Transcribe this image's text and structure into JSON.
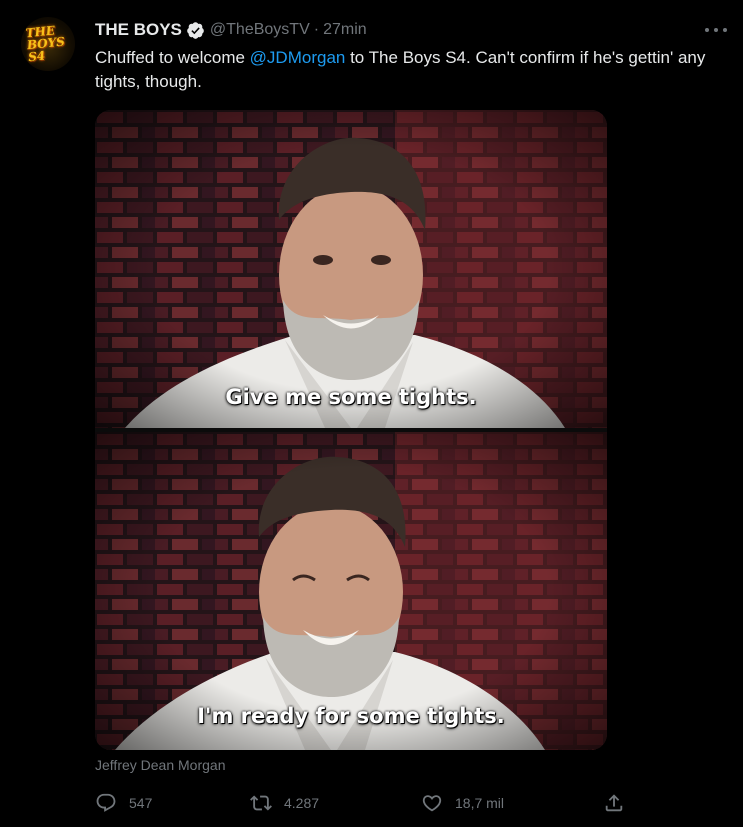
{
  "tweet": {
    "avatar_logo_lines": [
      "THE",
      "BOYS",
      "S4"
    ],
    "display_name": "THE BOYS",
    "handle": "@TheBoysTV",
    "separator": "·",
    "time": "27min",
    "text_before": "Chuffed to welcome ",
    "mention": "@JDMorgan",
    "text_after": " to The Boys S4. Can't confirm if he's gettin' any tights, though.",
    "media": {
      "top_caption": "Give me some tights.",
      "bottom_caption": "I'm ready for some tights."
    },
    "media_label": "Jeffrey Dean Morgan",
    "stats": {
      "replies": "547",
      "retweets": "4.287",
      "likes": "18,7 mil"
    }
  },
  "colors": {
    "background": "#000000",
    "text": "#e7e9ea",
    "secondary": "#71767b",
    "link": "#1d9bf0"
  },
  "icons": [
    "verified-badge-icon",
    "more-icon",
    "reply-icon",
    "retweet-icon",
    "like-icon",
    "share-icon"
  ]
}
